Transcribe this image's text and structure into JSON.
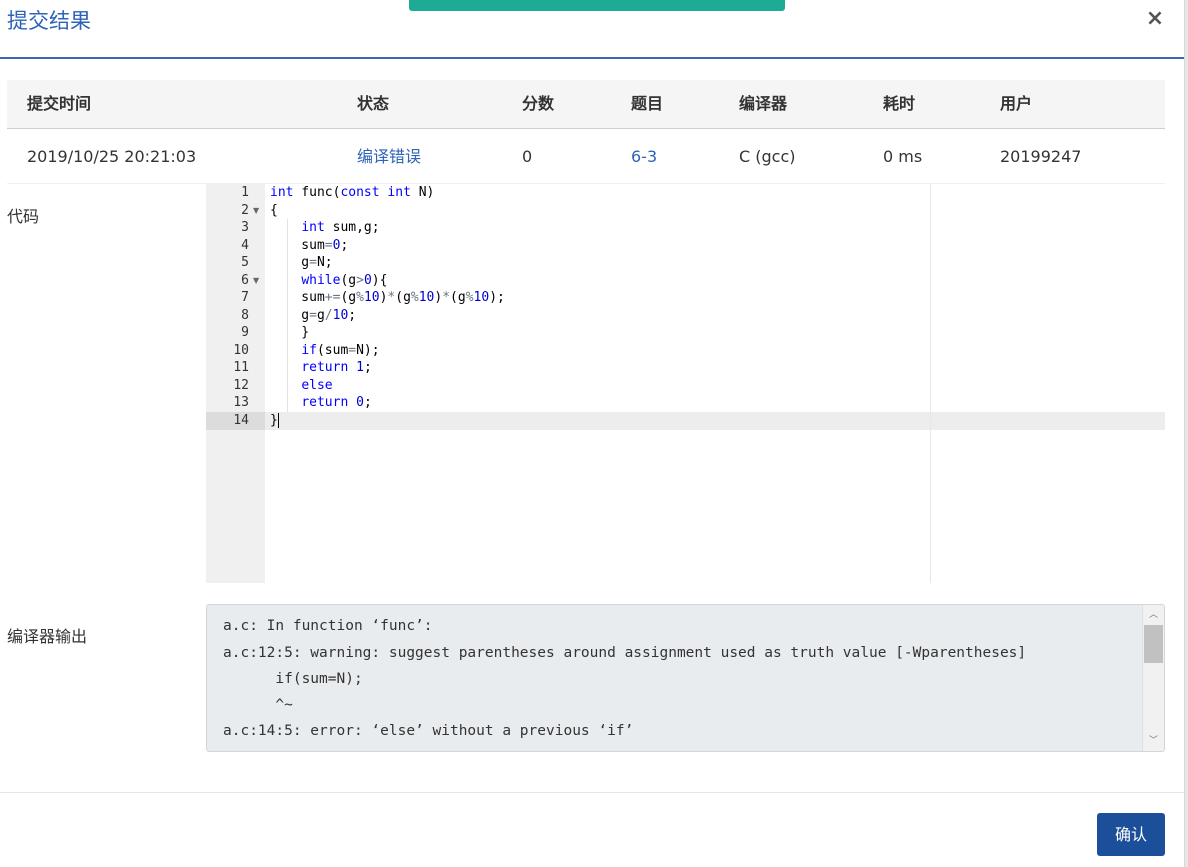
{
  "modal": {
    "title": "提交结果",
    "close_label": "×",
    "confirm_label": "确认"
  },
  "table": {
    "headers": [
      "提交时间",
      "状态",
      "分数",
      "题目",
      "编译器",
      "耗时",
      "用户"
    ],
    "row": {
      "time": "2019/10/25 20:21:03",
      "status": "编译错误",
      "score": "0",
      "problem": "6-3",
      "compiler": "C (gcc)",
      "duration": "0 ms",
      "user": "20199247"
    }
  },
  "labels": {
    "code": "代码",
    "compiler_output": "编译器输出"
  },
  "code_lines": [
    "int func(const int N)",
    "{",
    "    int sum,g;",
    "    sum=0;",
    "    g=N;",
    "    while(g>0){",
    "    sum+=(g%10)*(g%10)*(g%10);",
    "    g=g/10;",
    "    }",
    "    if(sum=N);",
    "    return 1;",
    "    else",
    "    return 0;",
    "}"
  ],
  "line_numbers": [
    "1",
    "2",
    "3",
    "4",
    "5",
    "6",
    "7",
    "8",
    "9",
    "10",
    "11",
    "12",
    "13",
    "14"
  ],
  "compiler_output": [
    "a.c: In function ‘func’:",
    "a.c:12:5: warning: suggest parentheses around assignment used as truth value [-Wparentheses]",
    "      if(sum=N);",
    "      ^~",
    "a.c:14:5: error: ‘else’ without a previous ‘if’"
  ],
  "colors": {
    "accent": "#2e63b8",
    "button": "#1b4f9a",
    "toast": "#1dab95"
  }
}
